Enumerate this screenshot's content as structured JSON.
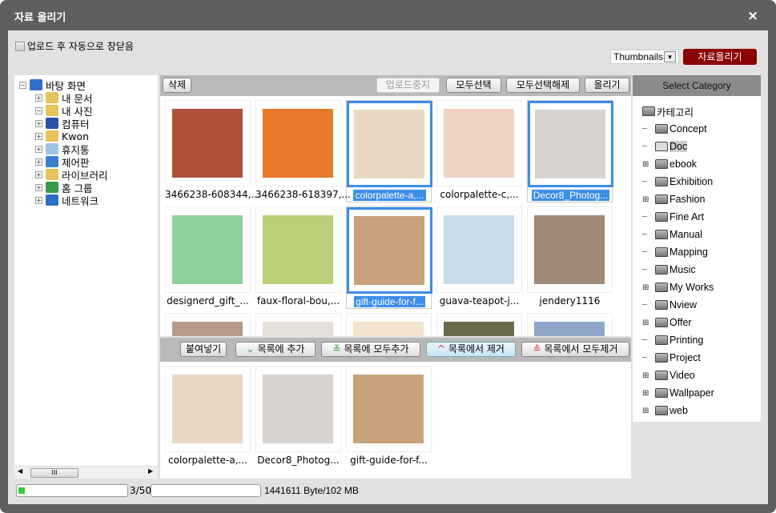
{
  "window": {
    "title": "자료 올리기",
    "close": "×"
  },
  "options": {
    "auto_close_label": "업로드 후 자동으로 창닫음",
    "auto_close_checked": false,
    "view_mode": "Thumbnails",
    "upload_button": "자료올리기"
  },
  "folder_tree": {
    "items": [
      {
        "label": "바탕 화면",
        "expander": "−",
        "icon": "desktop-icon",
        "color": "#2f6fc9",
        "level": 0
      },
      {
        "label": "내 문서",
        "expander": "+",
        "icon": "documents-folder-icon",
        "color": "#e8c25a",
        "level": 1
      },
      {
        "label": "내 사진",
        "expander": "−",
        "icon": "pictures-folder-icon",
        "color": "#e8c25a",
        "level": 1
      },
      {
        "label": "컴퓨터",
        "expander": "+",
        "icon": "computer-icon",
        "color": "#2a4fa8",
        "level": 1
      },
      {
        "label": "Kwon",
        "expander": "+",
        "icon": "user-folder-icon",
        "color": "#e8c25a",
        "level": 1
      },
      {
        "label": "휴지통",
        "expander": "+",
        "icon": "recycle-bin-icon",
        "color": "#9fc3e6",
        "level": 1
      },
      {
        "label": "제어판",
        "expander": "+",
        "icon": "control-panel-icon",
        "color": "#3b7fd0",
        "level": 1
      },
      {
        "label": "라이브러리",
        "expander": "+",
        "icon": "library-icon",
        "color": "#e8c25a",
        "level": 1
      },
      {
        "label": "홈 그룹",
        "expander": "+",
        "icon": "homegroup-icon",
        "color": "#3a9a4a",
        "level": 1
      },
      {
        "label": "네트워크",
        "expander": "+",
        "icon": "network-icon",
        "color": "#2a6fc0",
        "level": 1
      }
    ]
  },
  "toolbar": {
    "delete": "삭제",
    "stop_upload": "업로드중지",
    "select_all": "모두선택",
    "deselect_all": "모두선택해제",
    "upload": "올리기"
  },
  "files": [
    {
      "name": "3466238-608344,...",
      "selected": false,
      "color": "#b0503a"
    },
    {
      "name": "3466238-618397,...",
      "selected": false,
      "color": "#e8782a"
    },
    {
      "name": "colorpalette-a,...",
      "selected": true,
      "color": "#e9d9c4"
    },
    {
      "name": "colorpalette-c,...",
      "selected": false,
      "color": "#f1d3c3"
    },
    {
      "name": "Decor8_Photog...",
      "selected": true,
      "color": "#d7d3d0"
    },
    {
      "name": "designerd_gift_...",
      "selected": false,
      "color": "#8fd19a"
    },
    {
      "name": "faux-floral-bou,...",
      "selected": false,
      "color": "#b9cf7a"
    },
    {
      "name": "gift-guide-for-f...",
      "selected": true,
      "color": "#c7a27a"
    },
    {
      "name": "guava-teapot-j...",
      "selected": false,
      "color": "#c9dbe6"
    },
    {
      "name": "jendery1116",
      "selected": false,
      "color": "#a08a7a"
    },
    {
      "name": "",
      "selected": false,
      "color": "#b8998a"
    },
    {
      "name": "",
      "selected": false,
      "color": "#e5e0da"
    },
    {
      "name": "",
      "selected": false,
      "color": "#f3e4cf"
    },
    {
      "name": "",
      "selected": false,
      "color": "#6b6a4a"
    },
    {
      "name": "",
      "selected": false,
      "color": "#8fa6c9"
    }
  ],
  "list_toolbar": {
    "paste": "붙여넣기",
    "add": "목록에 추가",
    "add_all": "목록에 모두추가",
    "remove": "목록에서 제거",
    "remove_all": "목록에서 모두제거"
  },
  "upload_list": [
    {
      "name": "colorpalette-a,...",
      "color": "#e9d9c4"
    },
    {
      "name": "Decor8_Photog...",
      "color": "#d7d3d0"
    },
    {
      "name": "gift-guide-for-f...",
      "color": "#c7a27a"
    }
  ],
  "category": {
    "header": "Select Category",
    "root": "카테고리",
    "selected": "Doc",
    "items": [
      {
        "label": "Concept",
        "expandable": false
      },
      {
        "label": "Doc",
        "expandable": false
      },
      {
        "label": "ebook",
        "expandable": true
      },
      {
        "label": "Exhibition",
        "expandable": false
      },
      {
        "label": "Fashion",
        "expandable": true
      },
      {
        "label": "Fine Art",
        "expandable": false
      },
      {
        "label": "Manual",
        "expandable": false
      },
      {
        "label": "Mapping",
        "expandable": false
      },
      {
        "label": "Music",
        "expandable": false
      },
      {
        "label": "My Works",
        "expandable": true
      },
      {
        "label": "Nview",
        "expandable": false
      },
      {
        "label": "Offer",
        "expandable": true
      },
      {
        "label": "Printing",
        "expandable": false
      },
      {
        "label": "Project",
        "expandable": false
      },
      {
        "label": "Video",
        "expandable": true
      },
      {
        "label": "Wallpaper",
        "expandable": true
      },
      {
        "label": "web",
        "expandable": true
      }
    ]
  },
  "status": {
    "file_progress": 0.06,
    "file_count": "3/50",
    "size_progress": 0.0,
    "size_text": "1441611 Byte/102 MB"
  }
}
